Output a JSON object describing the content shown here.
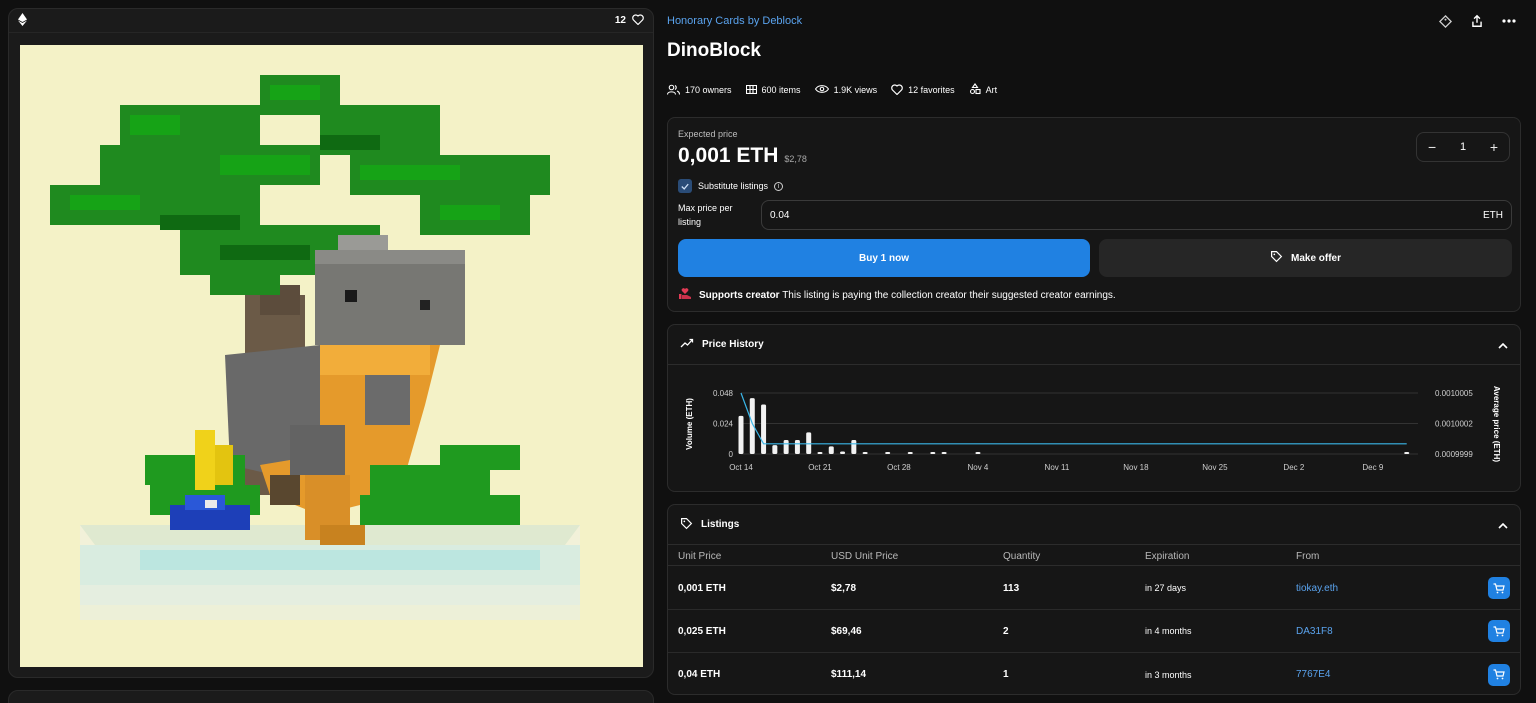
{
  "media": {
    "favorite_count": "12"
  },
  "header": {
    "collection": "Honorary Cards by Deblock",
    "title": "DinoBlock"
  },
  "stats": [
    {
      "icon": "owners-icon",
      "label": "170 owners"
    },
    {
      "icon": "grid-icon",
      "label": "600 items"
    },
    {
      "icon": "eye-icon",
      "label": "1.9K views"
    },
    {
      "icon": "heart-icon",
      "label": "12 favorites"
    },
    {
      "icon": "category-icon",
      "label": "Art"
    }
  ],
  "buy": {
    "expected_label": "Expected price",
    "price": "0,001 ETH",
    "price_usd": "$2,78",
    "quantity": "1",
    "substitute_label": "Substitute listings",
    "substitute_checked": true,
    "max_label": "Max price per listing",
    "max_value": "0.04",
    "max_unit": "ETH",
    "buy_label": "Buy 1 now",
    "offer_label": "Make offer",
    "supports_title": "Supports creator",
    "supports_text": "This listing is paying the collection creator their suggested creator earnings."
  },
  "history": {
    "title": "Price History"
  },
  "chart_data": {
    "type": "bar",
    "ylabel": "Volume (ETH)",
    "y2label": "Average price (ETH)",
    "y_ticks": [
      "0.048",
      "0.024",
      "0"
    ],
    "y2_ticks": [
      "0.0010005",
      "0.0010002",
      "0.0009999"
    ],
    "x_ticks": [
      "Oct 14",
      "Oct 21",
      "Oct 28",
      "Nov 4",
      "Nov 11",
      "Nov 18",
      "Nov 25",
      "Dec 2",
      "Dec 9"
    ],
    "ylim": [
      0,
      0.048
    ],
    "y2lim": [
      0.0009999,
      0.0010005
    ],
    "series": [
      {
        "type": "bar",
        "x": [
          "2024-10-14",
          "2024-10-15",
          "2024-10-16",
          "2024-10-17",
          "2024-10-18",
          "2024-10-19",
          "2024-10-20",
          "2024-10-21",
          "2024-10-22",
          "2024-10-23",
          "2024-10-24",
          "2024-10-25",
          "2024-10-27",
          "2024-10-29",
          "2024-10-31",
          "2024-11-01",
          "2024-11-04",
          "2024-12-12"
        ],
        "values": [
          0.03,
          0.044,
          0.039,
          0.007,
          0.011,
          0.011,
          0.017,
          0.001,
          0.006,
          0.002,
          0.011,
          0.001,
          0.001,
          0.001,
          0.001,
          0.001,
          0.001,
          0.001
        ]
      },
      {
        "type": "line",
        "x": [
          "2024-10-14",
          "2024-10-15",
          "2024-10-16",
          "2024-12-12"
        ],
        "values": [
          0.0010005,
          0.0010002,
          0.001,
          0.001
        ]
      }
    ]
  },
  "listings": {
    "title": "Listings",
    "columns": [
      "Unit Price",
      "USD Unit Price",
      "Quantity",
      "Expiration",
      "From"
    ],
    "rows": [
      {
        "price": "0,001 ETH",
        "usd": "$2,78",
        "qty": "113",
        "exp": "in 27 days",
        "from": "tiokay.eth"
      },
      {
        "price": "0,025 ETH",
        "usd": "$69,46",
        "qty": "2",
        "exp": "in 4 months",
        "from": "DA31F8"
      },
      {
        "price": "0,04 ETH",
        "usd": "$111,14",
        "qty": "1",
        "exp": "in 3 months",
        "from": "7767E4"
      }
    ]
  },
  "colors": {
    "accent": "#2081e2",
    "link": "#5aa3ee",
    "background": "#101010",
    "panel": "#161616"
  }
}
